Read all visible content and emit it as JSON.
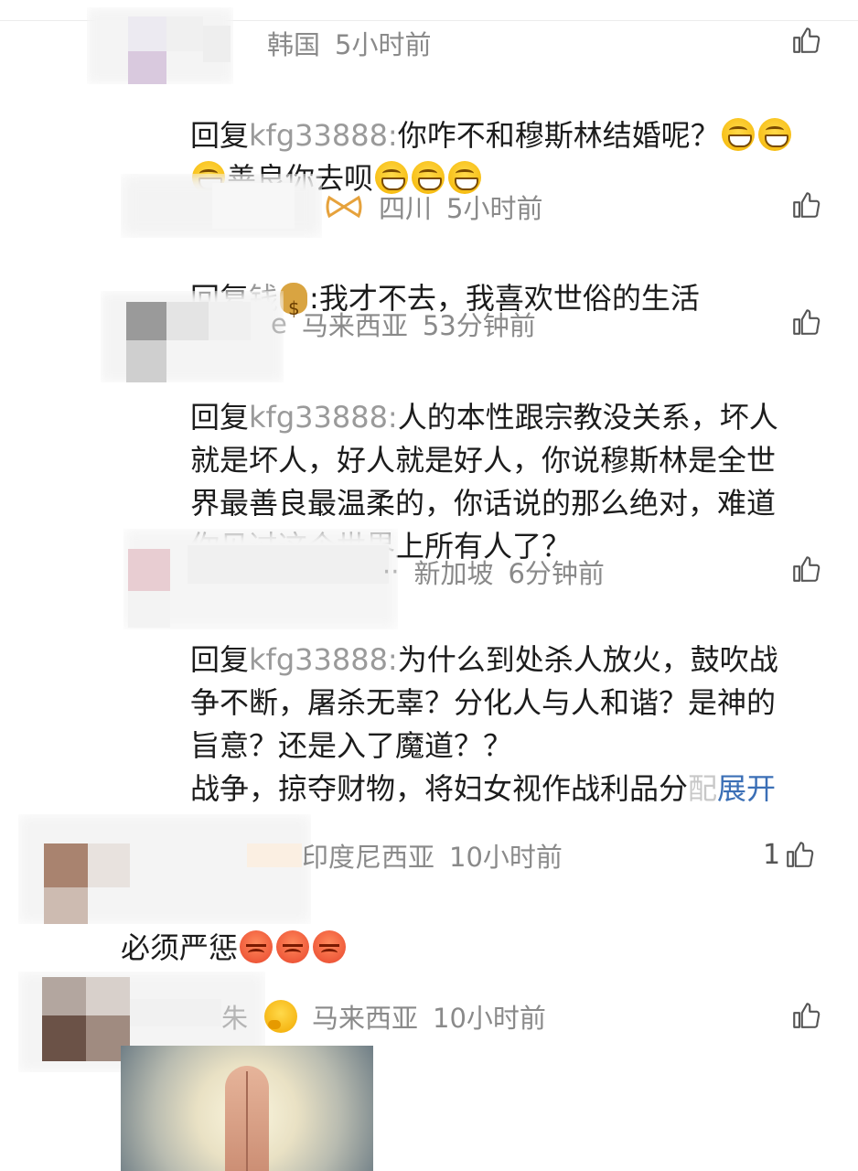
{
  "comments": [
    {
      "location": "韩国",
      "time": "5小时前",
      "reply_prefix": "回复",
      "reply_target": "kfg33888:",
      "text_line1": "你咋不和穆斯林结婚呢？",
      "text_line2": "善良你去呗"
    },
    {
      "location": "四川",
      "time": "5小时前",
      "reply_prefix": "回复",
      "reply_target": "钱",
      "text_line1": ":我才不去，我喜欢世俗的生活"
    },
    {
      "name_tail": "e",
      "location": "马来西亚",
      "time": "53分钟前",
      "reply_prefix": "回复",
      "reply_target": "kfg33888:",
      "text_line1": "人的本性跟宗教没关系，坏人",
      "text_line2": "就是坏人，好人就是好人，你说穆斯林是全世",
      "text_line3": "界最善良最温柔的，你话说的那么绝对，难道",
      "text_line4": "你见过这个世界上所有人了？"
    },
    {
      "name_tail": "··",
      "location": "新加坡",
      "time": "6分钟前",
      "reply_prefix": "回复",
      "reply_target": "kfg33888:",
      "text_line1": "为什么到处杀人放火，鼓吹战",
      "text_line2": "争不断，屠杀无辜？分化人与人和谐？是神的",
      "text_line3": "旨意？还是入了魔道？？",
      "text_line4": "战争，掠夺财物，将妇女视作战利品分",
      "text_fade": "配",
      "expand_label": "展开"
    },
    {
      "location": "印度尼西亚",
      "time": "10小时前",
      "like_count": "1",
      "text_line1": "必须严惩"
    },
    {
      "name_tail": "朱",
      "location": "马来西亚",
      "time": "10小时前"
    }
  ],
  "icons": {
    "like": "thumbs-up-outline-icon",
    "grin": "grinning-face-emoji",
    "money": "money-bag-emoji",
    "angry": "angry-face-emoji",
    "think": "thinking-face-emoji",
    "bow": "bow-emoji"
  }
}
